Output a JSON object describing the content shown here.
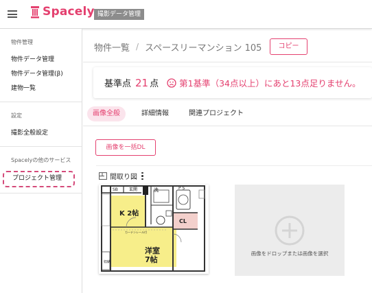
{
  "header": {
    "logo_text": "Spacely",
    "badge": "撮影データ管理"
  },
  "sidebar": {
    "sections": [
      {
        "title": "物件管理",
        "items": [
          "物件データ管理",
          "物件データ管理(β)",
          "建物一覧"
        ]
      },
      {
        "title": "設定",
        "items": [
          "撮影全般設定"
        ]
      },
      {
        "title": "Spacelyの他のサービス",
        "items": [
          "プロジェクト管理"
        ]
      }
    ]
  },
  "breadcrumb": {
    "root": "物件一覧",
    "separator": "/",
    "current": "スペースリーマンション 105",
    "copy_label": "コピー"
  },
  "score": {
    "label": "基準点",
    "value": "21",
    "unit": "点",
    "warning": "第1基準（34点以上）にあと13点足りません。"
  },
  "tabs": [
    {
      "label": "画像全般",
      "active": true
    },
    {
      "label": "詳細情報",
      "active": false
    },
    {
      "label": "関連プロジェクト",
      "active": false
    }
  ],
  "actions": {
    "download_all": "画像を一括DL"
  },
  "floorplan": {
    "title": "間取り図",
    "dropzone_text": "画像をドロップまたは画像を選択",
    "labels": {
      "sb": "SB",
      "entrance": "玄関",
      "wash": "洗",
      "ps": "P S",
      "kitchen": "K 2帖",
      "cl": "CL",
      "curtain": "カーテンレール付",
      "room": "洋室",
      "room_size": "7帖",
      "storage": "収納"
    }
  },
  "colors": {
    "accent": "#e4406f",
    "tab_active_bg": "#fbe4ec",
    "badge_bg": "#8c8c8c",
    "floorplan_yellow": "#f7ee8a",
    "floorplan_pink": "#f3d0cc"
  }
}
